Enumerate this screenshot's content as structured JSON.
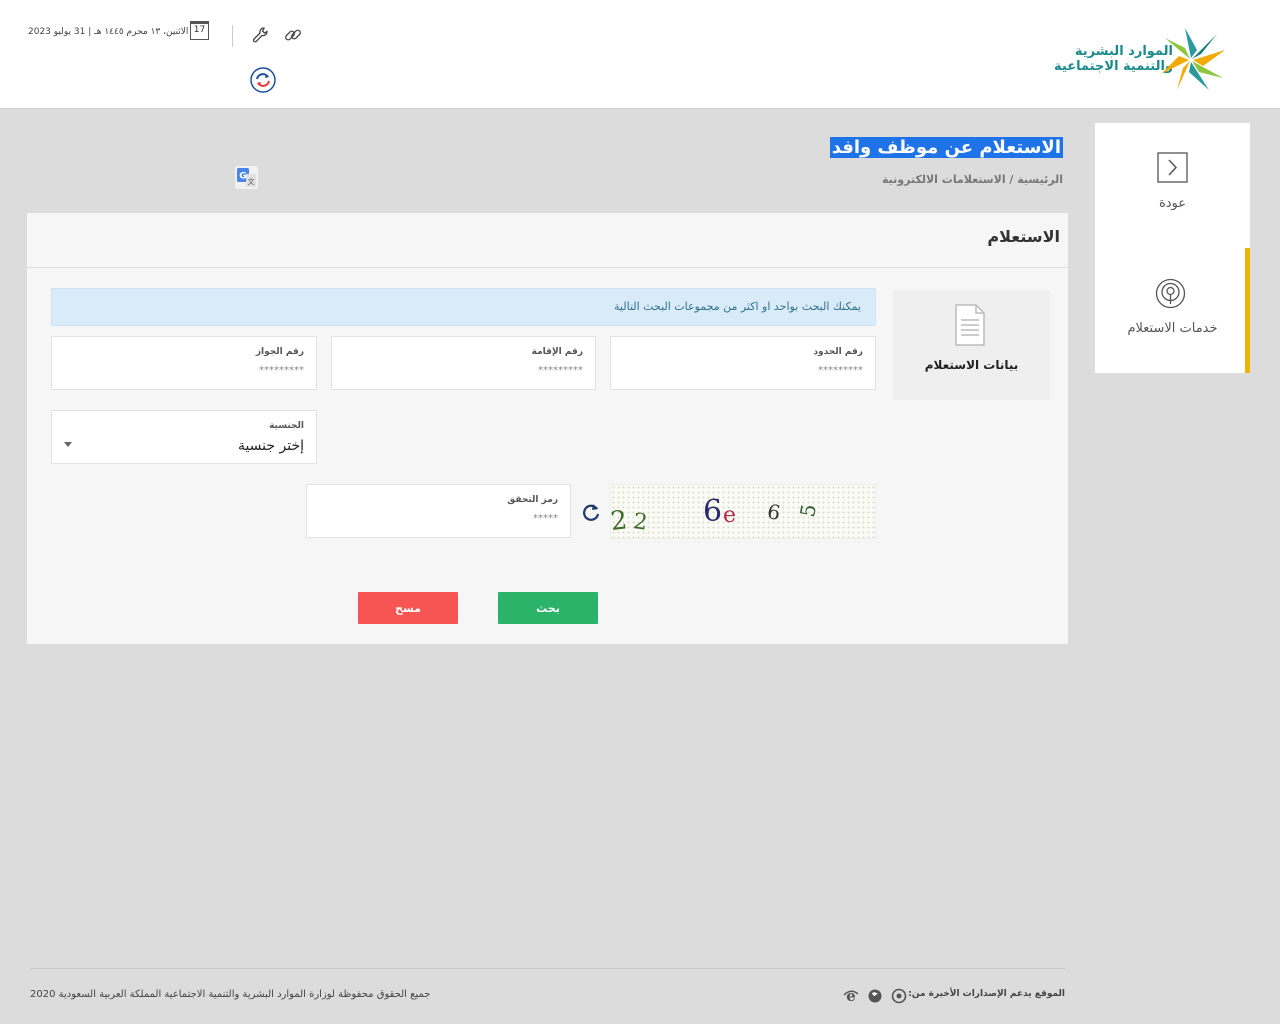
{
  "header": {
    "logo_line1": "الموارد البشرية",
    "logo_line2": "والتنمية الاجتماعية",
    "date": "الاثنين، ١٣ محرم ١٤٤٥ هـ | 31 يوليو 2023",
    "calendar_day": "17"
  },
  "sidebar": {
    "items": [
      {
        "label": "عودة",
        "icon": "chevron-right-icon"
      },
      {
        "label": "خدمات الاستعلام",
        "icon": "broadcast-icon",
        "active": true
      }
    ]
  },
  "page": {
    "title_selected": "الاستعلام عن موظف وافد",
    "title_rest": "",
    "breadcrumb": "الرئيسية / الاستعلامات الالكترونية"
  },
  "panel": {
    "title": "الاستعلام",
    "data_tab_label": "بيانات الاستعلام",
    "info": "يمكنك البحث بواحد او اكثر من مجموعات البحث التالية",
    "fields": {
      "border_number": {
        "label": "رقم الحدود",
        "placeholder": "*********"
      },
      "iqama_number": {
        "label": "رقم الإقامة",
        "placeholder": "*********"
      },
      "passport_number": {
        "label": "رقم الجواز",
        "placeholder": "*********"
      },
      "nationality": {
        "label": "الجنسية",
        "value": "إختر جنسية"
      },
      "captcha_code": {
        "label": "رمز التحقق",
        "placeholder": "*****"
      }
    },
    "captcha_text": "22 6e 6 5",
    "buttons": {
      "search": "بحث",
      "clear": "مسح"
    }
  },
  "footer": {
    "browsers_note": "الموقع يدعم الإصدارات الأخيرة من:",
    "copyright": "جميع الحقوق محفوظة لوزارة الموارد البشرية والتنمية الاجتماعية المملكة العربية السعودية 2020"
  },
  "colors": {
    "accent_teal": "#1a8a8a",
    "active_bar": "#f0b400",
    "search_button": "#2bb36a",
    "clear_button": "#f75454",
    "selection": "#1e73e8"
  }
}
